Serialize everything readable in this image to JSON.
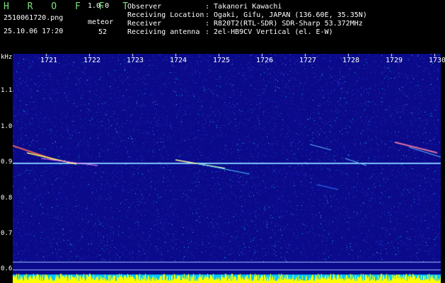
{
  "header": {
    "brand": "H R O F F T",
    "version": "1.0.0",
    "filename": "2510061720.png",
    "datetime": "25.10.06 17:20",
    "meteor_label": "meteor",
    "meteor_count": "52",
    "info": [
      {
        "key": "Observer",
        "value": ": Takanori Kawachi"
      },
      {
        "key": "Receiving Location",
        "value": ": Ogaki, Gifu, JAPAN (136.60E, 35.35N)"
      },
      {
        "key": "Receiver",
        "value": ": R820T2(RTL-SDR) SDR-Sharp 53.372MHz"
      },
      {
        "key": "Receiving antenna",
        "value": ": 2el-HB9CV Vertical (el. E-W)"
      }
    ]
  },
  "axis": {
    "unit_label": "kHz",
    "y_ticks": [
      "1.1",
      "1.0",
      "0.9",
      "0.8",
      "0.7",
      "0.6"
    ],
    "x_ticks": [
      "1721",
      "1722",
      "1723",
      "1724",
      "1725",
      "1726",
      "1727",
      "1728",
      "1729",
      "1730"
    ]
  },
  "colors": {
    "background": "#000000",
    "spectrum_bg": "#0a0a8a",
    "signal_line": "#9fd8ff",
    "brand": "#7ee07e",
    "level_bar": "#ffff00",
    "level_base": "#00c8ff"
  }
}
